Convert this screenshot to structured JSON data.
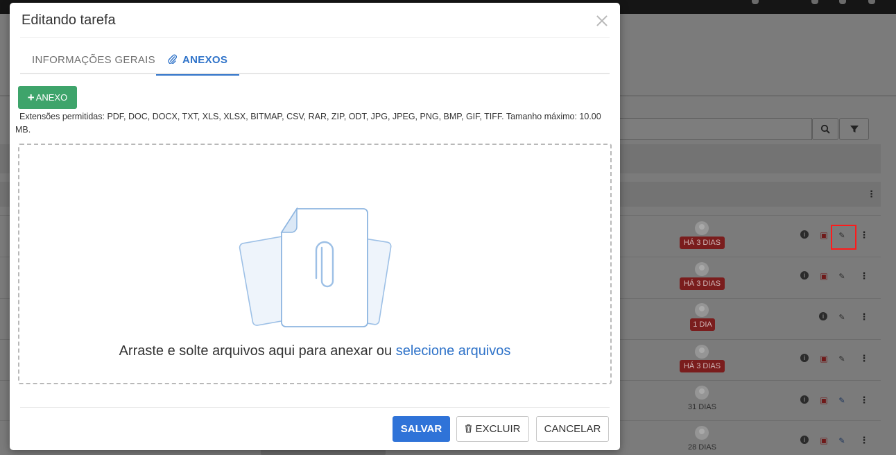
{
  "modal": {
    "title": "Editando tarefa",
    "tabs": [
      {
        "label": "INFORMAÇÕES GERAIS",
        "active": false
      },
      {
        "label": "ANEXOS",
        "active": true
      }
    ],
    "add_button_label": "ANEXO",
    "extensions_text": "Extensões permitidas: PDF, DOC, DOCX, TXT, XLS, XLSX, BITMAP, CSV, RAR, ZIP, ODT, JPG, JPEG, PNG, BMP, GIF, TIFF.   Tamanho máximo: 10.00 MB.",
    "dropzone": {
      "text": "Arraste e solte arquivos aqui para anexar ou",
      "link": "selecione arquivos"
    },
    "buttons": {
      "save": "SALVAR",
      "delete": "EXCLUIR",
      "cancel": "CANCELAR"
    }
  },
  "background_rows": [
    {
      "due": "HÁ 3 DIAS",
      "overdue": true
    },
    {
      "due": "HÁ 3 DIAS",
      "overdue": true
    },
    {
      "due": "1 DIA",
      "overdue": true
    },
    {
      "due": "HÁ 3 DIAS",
      "overdue": true
    },
    {
      "due": "31 DIAS",
      "overdue": false
    },
    {
      "due": "28 DIAS",
      "overdue": false
    }
  ],
  "colors": {
    "primary": "#2f73d8",
    "success": "#3ea46b",
    "overdue": "#7a1d1d",
    "highlight": "#ff1a1a"
  }
}
